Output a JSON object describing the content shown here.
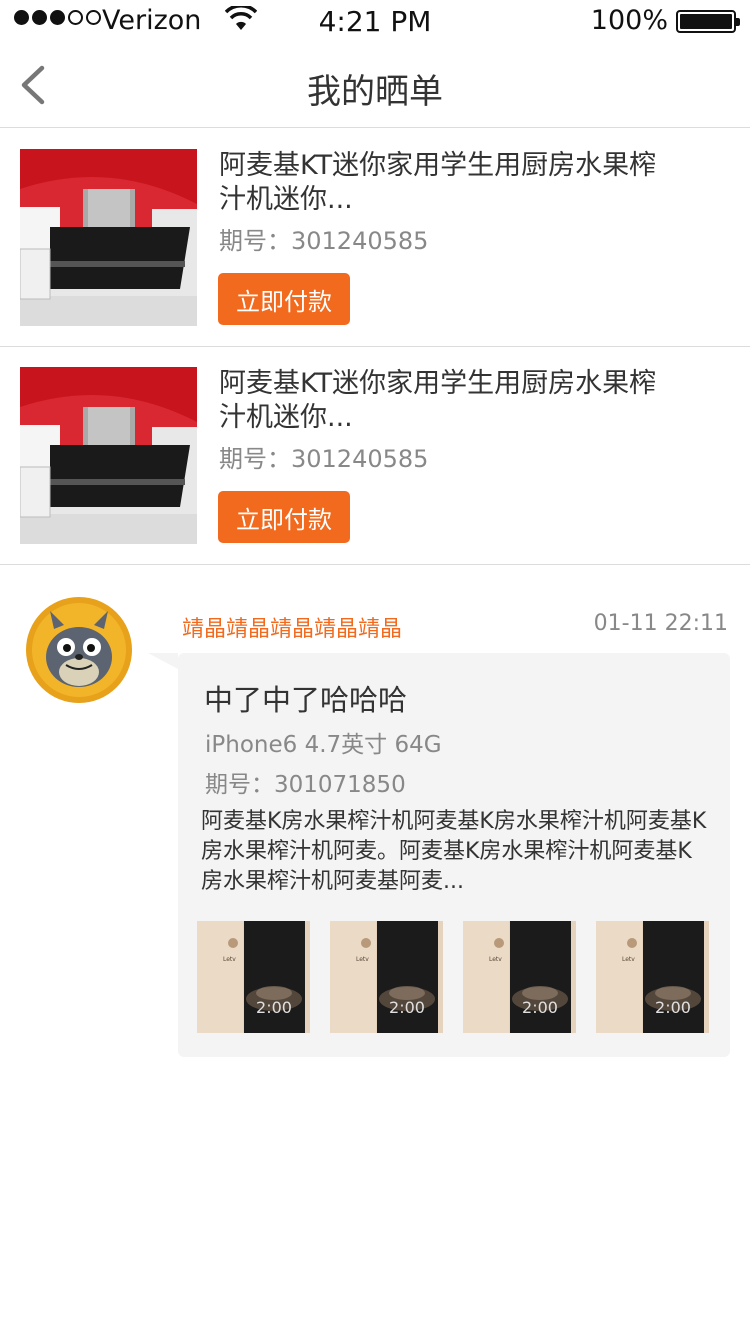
{
  "status_bar": {
    "carrier": "Verizon",
    "time": "4:21 PM",
    "battery": "100%"
  },
  "nav": {
    "title": "我的晒单"
  },
  "orders": [
    {
      "name": "阿麦基KT迷你家用学生用厨房水果榨汁机迷你...",
      "period": "期号：301240585",
      "pay_label": "立即付款"
    },
    {
      "name": "阿麦基KT迷你家用学生用厨房水果榨汁机迷你...",
      "period": "期号：301240585",
      "pay_label": "立即付款"
    }
  ],
  "post": {
    "username": "靖晶靖晶靖晶靖晶靖晶",
    "time": "01-11 22:11",
    "headline": "中了中了哈哈哈",
    "product": "iPhone6 4.7英寸 64G",
    "period": "期号：301071850",
    "body": "阿麦基K房水果榨汁机阿麦基K房水果榨汁机阿麦基K房水果榨汁机阿麦。阿麦基K房水果榨汁机阿麦基K房水果榨汁机阿麦基阿麦...",
    "photo_clock": "2:00",
    "photo_brand": "Letv"
  },
  "colors": {
    "accent": "#f26a1d",
    "divider": "#dcdcdc",
    "bubble": "#f4f4f4"
  },
  "icons": [
    "wifi-icon",
    "battery-icon",
    "back-arrow-icon",
    "avatar-icon"
  ]
}
